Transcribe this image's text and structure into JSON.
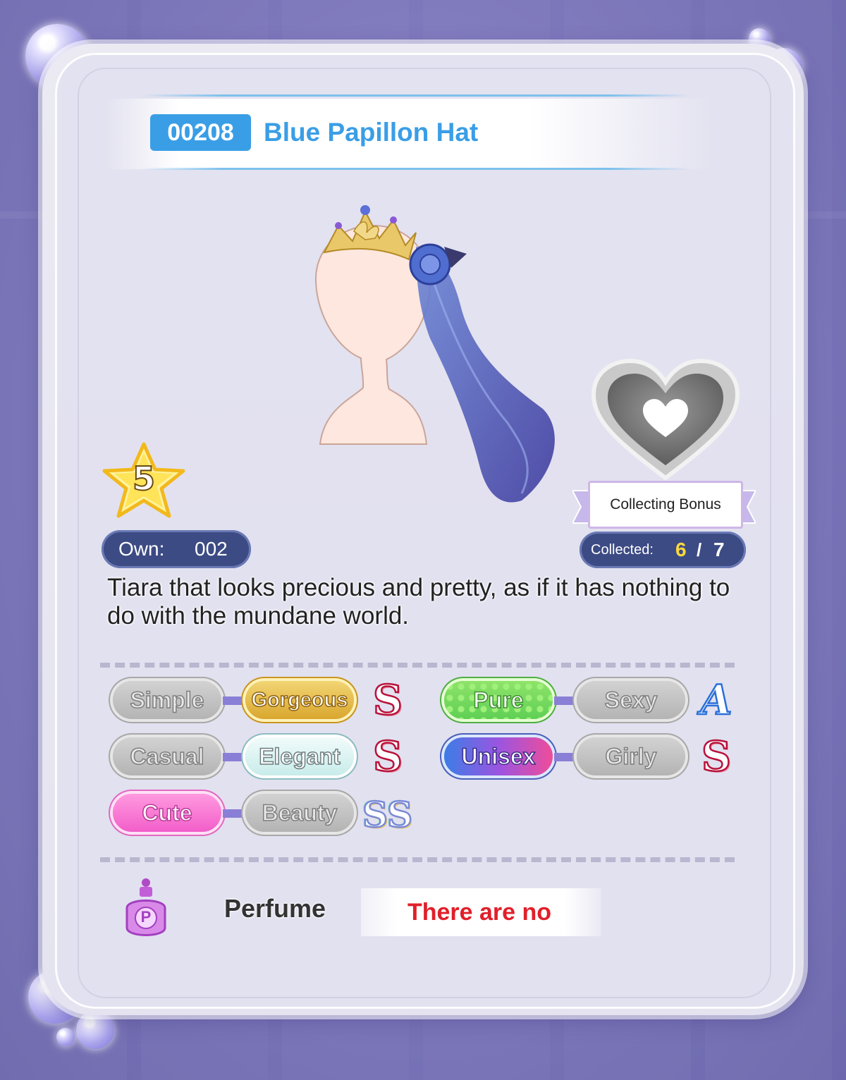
{
  "item": {
    "id": "00208",
    "name": "Blue Papillon Hat",
    "rarity": "5",
    "description": "Tiara that looks precious and pretty, as if it has nothing to do with the mundane world."
  },
  "own": {
    "label": "Own:",
    "value": "002"
  },
  "collecting_bonus": {
    "label": "Collecting Bonus",
    "collected_label": "Collected:",
    "collected": "6",
    "separator": "/",
    "total": "7"
  },
  "attributes": [
    {
      "left": "Simple",
      "right": "Gorgeous",
      "grade": "S",
      "selected": "right"
    },
    {
      "left": "Pure",
      "right": "Sexy",
      "grade": "A",
      "selected": "left"
    },
    {
      "left": "Casual",
      "right": "Elegant",
      "grade": "S",
      "selected": "right"
    },
    {
      "left": "Unisex",
      "right": "Girly",
      "grade": "S",
      "selected": "left"
    },
    {
      "left": "Cute",
      "right": "Beauty",
      "grade": "SS",
      "selected": "left"
    }
  ],
  "perfume": {
    "icon_letter": "P",
    "label": "Perfume",
    "value": "There are no"
  },
  "colors": {
    "accent": "#3a9ee6",
    "pill": "#3c4b84",
    "collected_highlight": "#ffd93c",
    "grade_s": "#b8123a",
    "grade_a": "#2a6fd8",
    "perfume_warning": "#e0202a"
  },
  "icons": [
    "heart-icon",
    "star-icon",
    "perfume-bottle-icon",
    "bubble-icon"
  ]
}
